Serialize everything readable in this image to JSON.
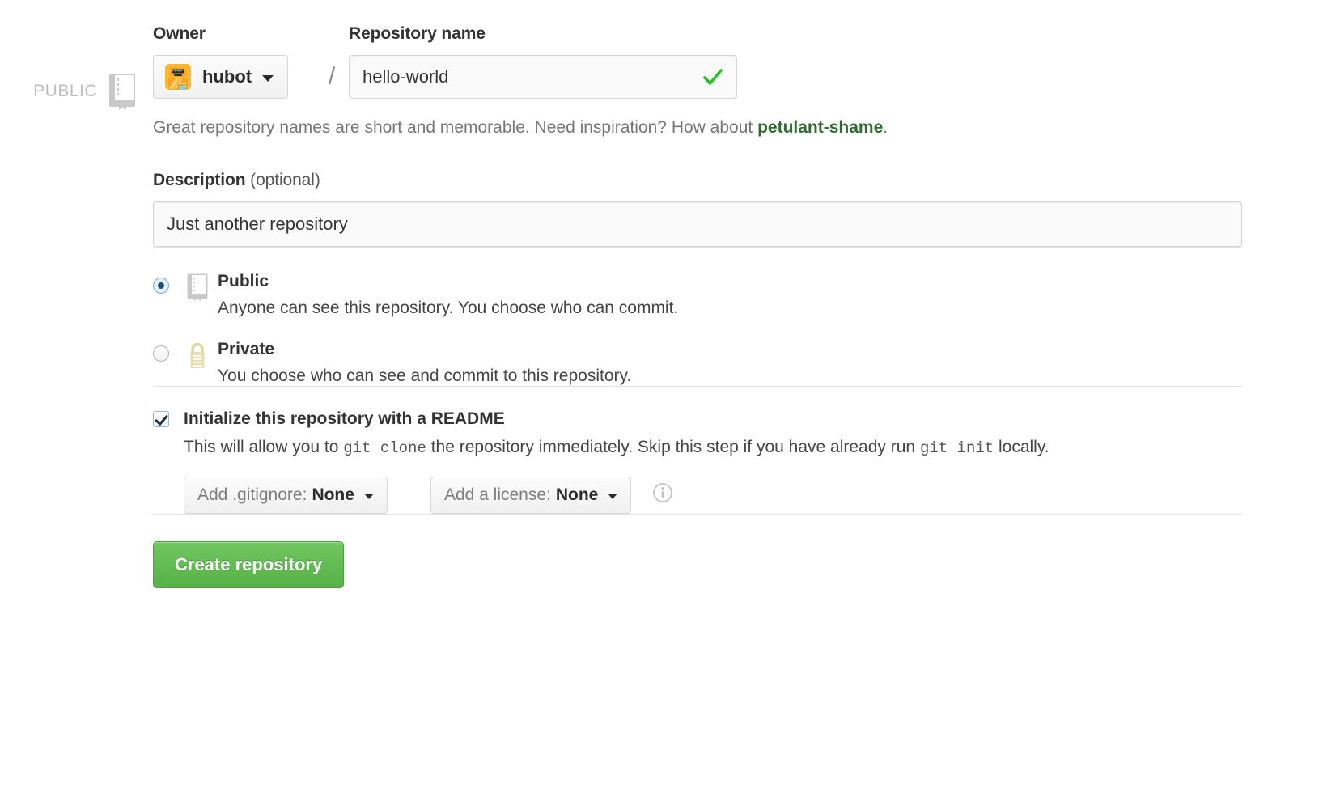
{
  "gutter": {
    "visibility_label": "PUBLIC",
    "repo_icon": "book-icon"
  },
  "owner": {
    "label": "Owner",
    "name": "hubot",
    "avatar": "hubot-avatar",
    "caret": "chevron-down-icon"
  },
  "separator": "/",
  "repository_name": {
    "label": "Repository name",
    "value": "hello-world",
    "placeholder": "",
    "valid_icon": "check-icon"
  },
  "name_hint": {
    "before": "Great repository names are short and memorable. Need inspiration? How about ",
    "suggestion": "petulant-shame",
    "after": "."
  },
  "description": {
    "label": "Description",
    "optional": "(optional)",
    "value": "Just another repository",
    "placeholder": ""
  },
  "visibility": {
    "options": [
      {
        "id": "public",
        "title": "Public",
        "description": "Anyone can see this repository. You choose who can commit.",
        "icon": "book-icon",
        "selected": true
      },
      {
        "id": "private",
        "title": "Private",
        "description": "You choose who can see and commit to this repository.",
        "icon": "lock-icon",
        "selected": false
      }
    ]
  },
  "readme": {
    "checked": true,
    "title": "Initialize this repository with a README",
    "desc_part1": "This will allow you to ",
    "desc_code1": "git clone",
    "desc_part2": " the repository immediately. Skip this step if you have already run ",
    "desc_code2": "git init",
    "desc_part3": " locally."
  },
  "gitignore_dropdown": {
    "label": "Add .gitignore:",
    "value": "None",
    "caret": "chevron-down-icon"
  },
  "license_dropdown": {
    "label": "Add a license:",
    "value": "None",
    "caret": "chevron-down-icon",
    "info": "info-icon"
  },
  "submit": {
    "label": "Create repository"
  },
  "colors": {
    "accent_green": "#62bb52",
    "link_green": "#2f6b2f",
    "check_green": "#27c327",
    "lock_tan": "#e3d9a8",
    "icon_gray": "#c9c9c9",
    "text": "#333333",
    "muted_text": "#767676"
  }
}
